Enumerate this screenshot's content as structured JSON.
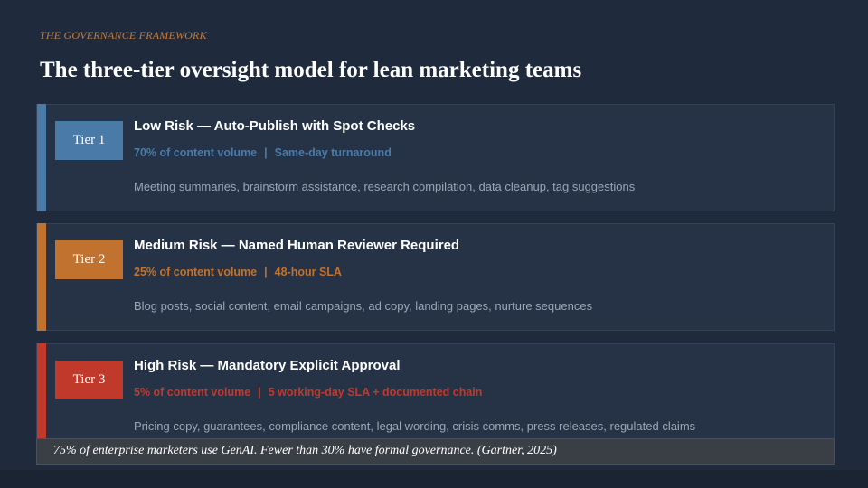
{
  "header": {
    "kicker": "THE GOVERNANCE FRAMEWORK",
    "title": "The three-tier oversight model for lean marketing teams"
  },
  "tiers": [
    {
      "badge": "Tier 1",
      "heading": "Low Risk — Auto-Publish with Spot Checks",
      "volume": "70% of content volume",
      "separator": "|",
      "turnaround": "Same-day turnaround",
      "description": "Meeting summaries, brainstorm assistance, research compilation, data cleanup, tag suggestions",
      "color": "#4a7ba8"
    },
    {
      "badge": "Tier 2",
      "heading": "Medium Risk — Named Human Reviewer Required",
      "volume": "25% of content volume",
      "separator": "|",
      "turnaround": "48-hour SLA",
      "description": "Blog posts, social content, email campaigns, ad copy, landing pages, nurture sequences",
      "color": "#c0722e"
    },
    {
      "badge": "Tier 3",
      "heading": "High Risk — Mandatory Explicit Approval",
      "volume": "5% of content volume",
      "separator": "|",
      "turnaround": "5 working-day SLA + documented chain",
      "description": "Pricing copy, guarantees, compliance content, legal wording, crisis comms, press releases, regulated claims",
      "color": "#c0392b"
    }
  ],
  "footnote": "75% of enterprise marketers use GenAI. Fewer than 30% have formal governance. (Gartner, 2025)"
}
